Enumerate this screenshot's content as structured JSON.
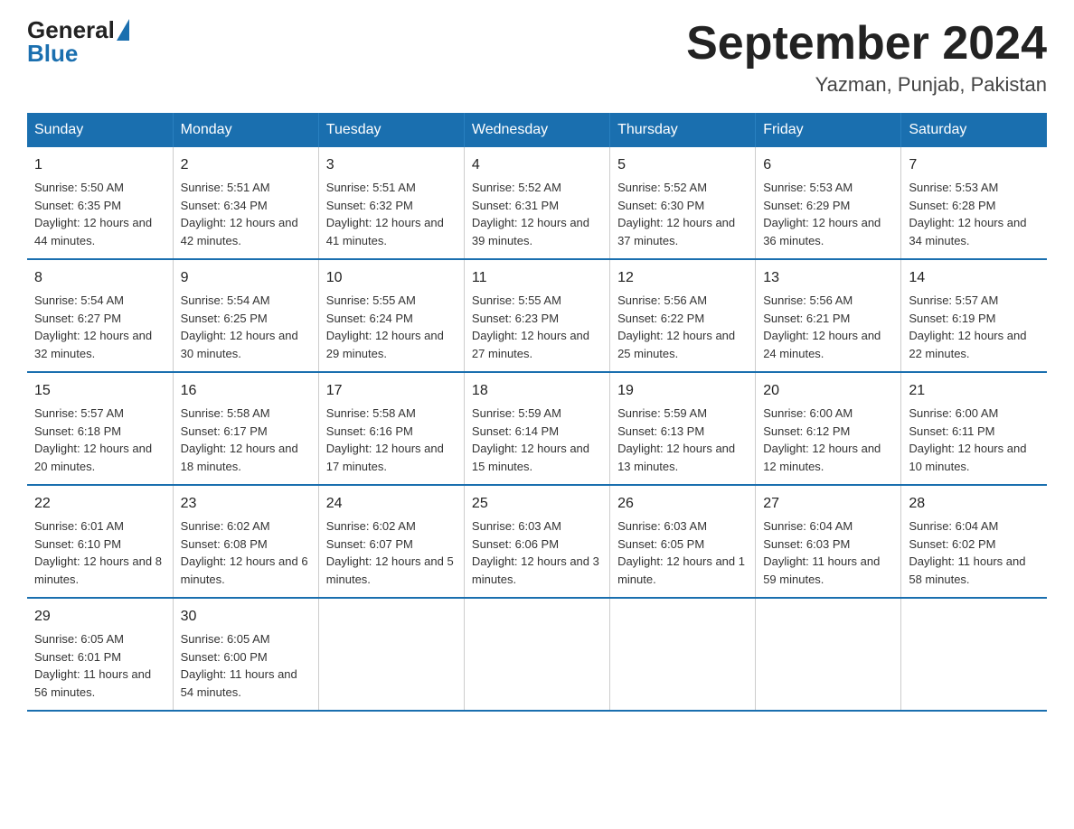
{
  "header": {
    "logo": {
      "general": "General",
      "blue": "Blue"
    },
    "title": "September 2024",
    "subtitle": "Yazman, Punjab, Pakistan"
  },
  "columns": [
    "Sunday",
    "Monday",
    "Tuesday",
    "Wednesday",
    "Thursday",
    "Friday",
    "Saturday"
  ],
  "weeks": [
    [
      {
        "day": "1",
        "sunrise": "5:50 AM",
        "sunset": "6:35 PM",
        "daylight": "12 hours and 44 minutes."
      },
      {
        "day": "2",
        "sunrise": "5:51 AM",
        "sunset": "6:34 PM",
        "daylight": "12 hours and 42 minutes."
      },
      {
        "day": "3",
        "sunrise": "5:51 AM",
        "sunset": "6:32 PM",
        "daylight": "12 hours and 41 minutes."
      },
      {
        "day": "4",
        "sunrise": "5:52 AM",
        "sunset": "6:31 PM",
        "daylight": "12 hours and 39 minutes."
      },
      {
        "day": "5",
        "sunrise": "5:52 AM",
        "sunset": "6:30 PM",
        "daylight": "12 hours and 37 minutes."
      },
      {
        "day": "6",
        "sunrise": "5:53 AM",
        "sunset": "6:29 PM",
        "daylight": "12 hours and 36 minutes."
      },
      {
        "day": "7",
        "sunrise": "5:53 AM",
        "sunset": "6:28 PM",
        "daylight": "12 hours and 34 minutes."
      }
    ],
    [
      {
        "day": "8",
        "sunrise": "5:54 AM",
        "sunset": "6:27 PM",
        "daylight": "12 hours and 32 minutes."
      },
      {
        "day": "9",
        "sunrise": "5:54 AM",
        "sunset": "6:25 PM",
        "daylight": "12 hours and 30 minutes."
      },
      {
        "day": "10",
        "sunrise": "5:55 AM",
        "sunset": "6:24 PM",
        "daylight": "12 hours and 29 minutes."
      },
      {
        "day": "11",
        "sunrise": "5:55 AM",
        "sunset": "6:23 PM",
        "daylight": "12 hours and 27 minutes."
      },
      {
        "day": "12",
        "sunrise": "5:56 AM",
        "sunset": "6:22 PM",
        "daylight": "12 hours and 25 minutes."
      },
      {
        "day": "13",
        "sunrise": "5:56 AM",
        "sunset": "6:21 PM",
        "daylight": "12 hours and 24 minutes."
      },
      {
        "day": "14",
        "sunrise": "5:57 AM",
        "sunset": "6:19 PM",
        "daylight": "12 hours and 22 minutes."
      }
    ],
    [
      {
        "day": "15",
        "sunrise": "5:57 AM",
        "sunset": "6:18 PM",
        "daylight": "12 hours and 20 minutes."
      },
      {
        "day": "16",
        "sunrise": "5:58 AM",
        "sunset": "6:17 PM",
        "daylight": "12 hours and 18 minutes."
      },
      {
        "day": "17",
        "sunrise": "5:58 AM",
        "sunset": "6:16 PM",
        "daylight": "12 hours and 17 minutes."
      },
      {
        "day": "18",
        "sunrise": "5:59 AM",
        "sunset": "6:14 PM",
        "daylight": "12 hours and 15 minutes."
      },
      {
        "day": "19",
        "sunrise": "5:59 AM",
        "sunset": "6:13 PM",
        "daylight": "12 hours and 13 minutes."
      },
      {
        "day": "20",
        "sunrise": "6:00 AM",
        "sunset": "6:12 PM",
        "daylight": "12 hours and 12 minutes."
      },
      {
        "day": "21",
        "sunrise": "6:00 AM",
        "sunset": "6:11 PM",
        "daylight": "12 hours and 10 minutes."
      }
    ],
    [
      {
        "day": "22",
        "sunrise": "6:01 AM",
        "sunset": "6:10 PM",
        "daylight": "12 hours and 8 minutes."
      },
      {
        "day": "23",
        "sunrise": "6:02 AM",
        "sunset": "6:08 PM",
        "daylight": "12 hours and 6 minutes."
      },
      {
        "day": "24",
        "sunrise": "6:02 AM",
        "sunset": "6:07 PM",
        "daylight": "12 hours and 5 minutes."
      },
      {
        "day": "25",
        "sunrise": "6:03 AM",
        "sunset": "6:06 PM",
        "daylight": "12 hours and 3 minutes."
      },
      {
        "day": "26",
        "sunrise": "6:03 AM",
        "sunset": "6:05 PM",
        "daylight": "12 hours and 1 minute."
      },
      {
        "day": "27",
        "sunrise": "6:04 AM",
        "sunset": "6:03 PM",
        "daylight": "11 hours and 59 minutes."
      },
      {
        "day": "28",
        "sunrise": "6:04 AM",
        "sunset": "6:02 PM",
        "daylight": "11 hours and 58 minutes."
      }
    ],
    [
      {
        "day": "29",
        "sunrise": "6:05 AM",
        "sunset": "6:01 PM",
        "daylight": "11 hours and 56 minutes."
      },
      {
        "day": "30",
        "sunrise": "6:05 AM",
        "sunset": "6:00 PM",
        "daylight": "11 hours and 54 minutes."
      },
      null,
      null,
      null,
      null,
      null
    ]
  ]
}
